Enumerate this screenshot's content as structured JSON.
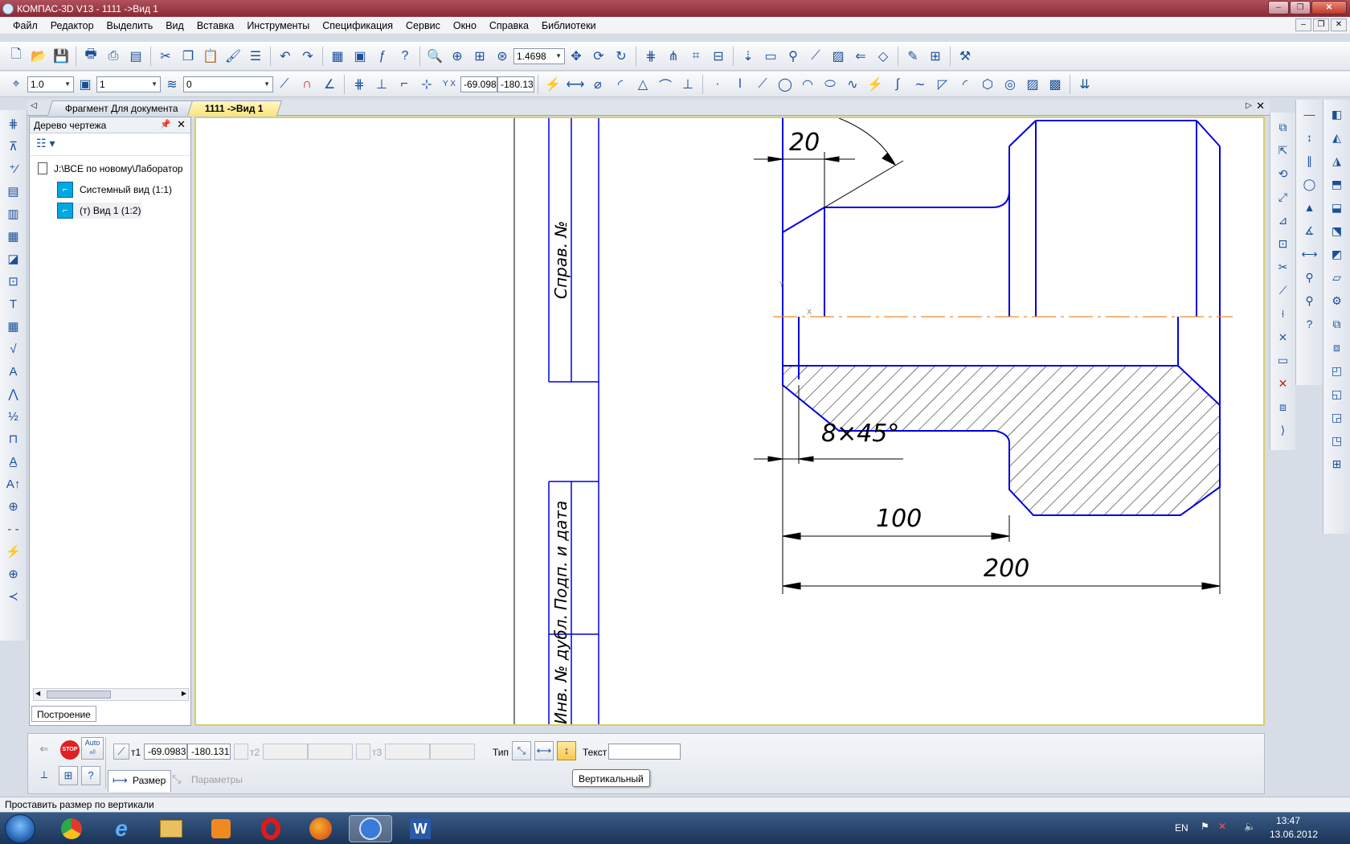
{
  "window": {
    "title": "КОМПАС-3D V13 - 1111 ->Вид 1"
  },
  "menu": [
    "Файл",
    "Редактор",
    "Выделить",
    "Вид",
    "Вставка",
    "Инструменты",
    "Спецификация",
    "Сервис",
    "Окно",
    "Справка",
    "Библиотеки"
  ],
  "toolbar": {
    "zoom_value": "1.4698",
    "line_scale": "1.0",
    "layer_value": "1",
    "style_value": "0",
    "coord_x": "-69.098",
    "coord_y": "-180.13"
  },
  "doc_tabs": [
    {
      "label": "Фрагмент Для документа",
      "active": false
    },
    {
      "label": "1111 ->Вид 1",
      "active": true
    }
  ],
  "tree_panel": {
    "title": "Дерево чертежа",
    "items": [
      {
        "label": "J:\\ВСЕ по новому\\Лаборатор"
      },
      {
        "label": "Системный вид (1:1)"
      },
      {
        "label": "(т) Вид 1 (1:2)"
      }
    ],
    "footer_tab": "Построение"
  },
  "drawing": {
    "stamp_labels": [
      "Справ. №",
      "Подп. и дата",
      "Инв. № дубл."
    ],
    "dimensions": [
      "20",
      "8×45°",
      "100",
      "200"
    ],
    "axis_labels": [
      "Y",
      "X"
    ]
  },
  "property_bar": {
    "auto_label": "Auto",
    "stop_label": "STOP",
    "t1_label": "т1",
    "t1_x": "-69.0983",
    "t1_y": "-180.131",
    "t2_label": "т2",
    "t3_label": "т3",
    "type_label": "Тип",
    "text_label": "Текст",
    "text_value": "",
    "tab_size": "Размер",
    "tab_params": "Параметры",
    "tooltip": "Вертикальный"
  },
  "status": {
    "message": "Проставить размер по вертикали"
  },
  "taskbar": {
    "language": "EN",
    "time": "13:47",
    "date": "13.06.2012"
  },
  "colors": {
    "drawing_line": "#0000e0",
    "axis_line": "#f08a30",
    "dimension_line": "#000000"
  }
}
